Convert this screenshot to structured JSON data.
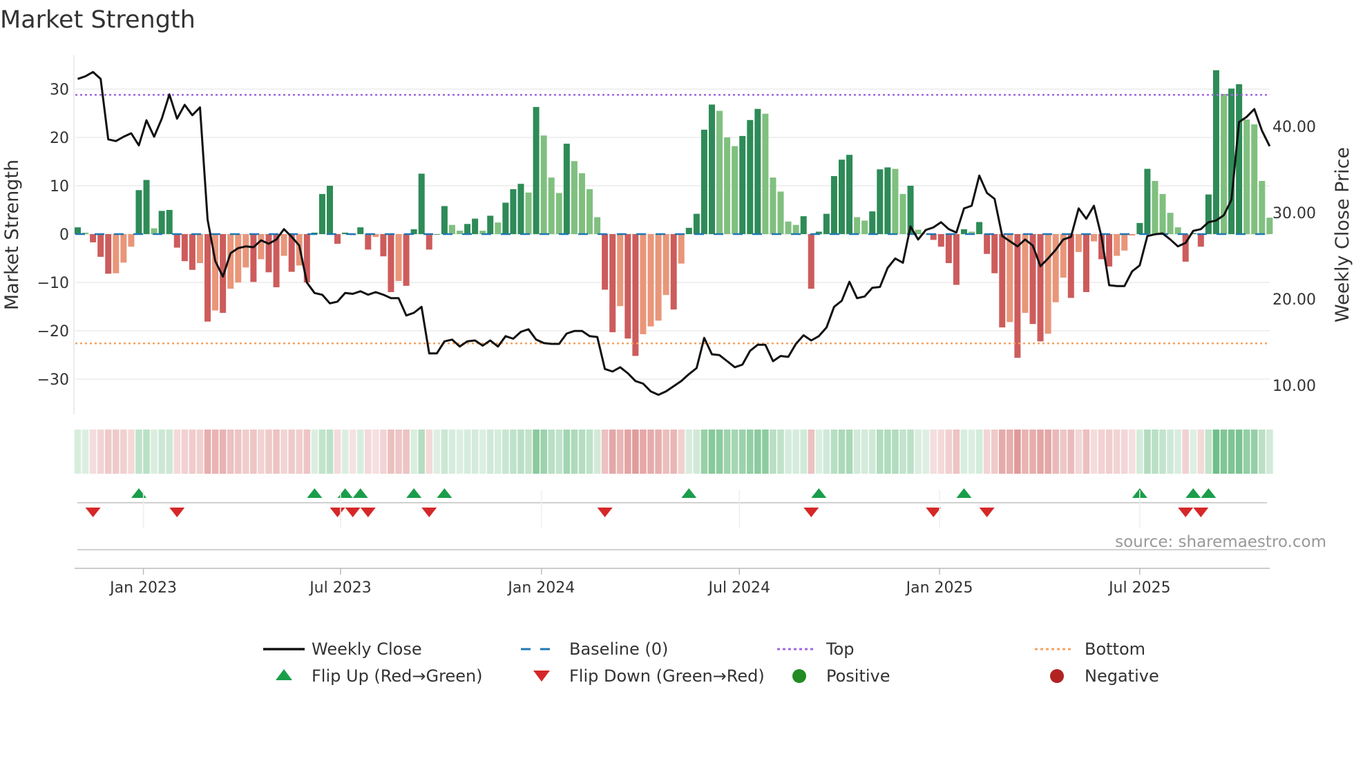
{
  "chart_data": {
    "type": "bar",
    "title": "Market Strength",
    "ylabel": "Market Strength",
    "y2label": "Weekly Close Price",
    "ylim": [
      -36,
      36
    ],
    "y2lim": [
      7,
      47
    ],
    "yticks": [
      "30",
      "20",
      "10",
      "0",
      "−10",
      "−20",
      "−30"
    ],
    "ytick_values": [
      30,
      20,
      10,
      0,
      -10,
      -20,
      -30
    ],
    "y2ticks": [
      "40.00",
      "30.00",
      "20.00",
      "10.00"
    ],
    "y2tick_values": [
      40,
      30,
      20,
      10
    ],
    "xticks": [
      "Jan 2023",
      "Jul 2023",
      "Jan 2024",
      "Jul 2024",
      "Jan 2025",
      "Jul 2025"
    ],
    "xtick_week_index": [
      8.6,
      34.4,
      60.7,
      86.6,
      112.8,
      139.0
    ],
    "top_level": 28.8,
    "bottom_level": -22.6,
    "baseline": 0,
    "strength": [
      1.4,
      0.3,
      -1.7,
      -4.7,
      -8.2,
      -8.1,
      -5.9,
      -2.6,
      9.1,
      11.2,
      1.2,
      4.8,
      5.0,
      -2.8,
      -5.6,
      -7.4,
      -6.0,
      -18.1,
      -15.8,
      -16.3,
      -11.3,
      -10.0,
      -6.9,
      -9.9,
      -5.2,
      -7.9,
      -11.0,
      -4.5,
      -7.8,
      -6.5,
      -10.0,
      0.3,
      8.3,
      10.0,
      -2.0,
      0.3,
      -0.2,
      1.4,
      -3.2,
      -0.6,
      -4.6,
      -12.0,
      -9.7,
      -10.7,
      1.0,
      12.5,
      -3.2,
      0,
      5.8,
      1.9,
      0.7,
      2.1,
      3.2,
      0.7,
      3.8,
      2.4,
      6.5,
      9.3,
      10.4,
      8.6,
      26.3,
      20.4,
      11.7,
      8.5,
      18.7,
      15.1,
      12.6,
      9.3,
      3.5,
      -11.5,
      -20.3,
      -14.9,
      -21.6,
      -25.2,
      -20.7,
      -19.1,
      -17.9,
      -12.6,
      -15.6,
      -6.1,
      1.3,
      4.2,
      21.6,
      26.8,
      25.5,
      20.0,
      18.2,
      20.3,
      23.6,
      25.9,
      24.9,
      11.7,
      8.8,
      2.6,
      1.9,
      3.7,
      -11.3,
      0.5,
      4.2,
      12.0,
      15.4,
      16.4,
      3.5,
      2.8,
      4.7,
      13.4,
      13.8,
      13.5,
      8.3,
      10.0,
      0.9,
      0.1,
      -1.2,
      -2.6,
      -6.0,
      -10.5,
      1.0,
      0.5,
      2.5,
      -4.1,
      -8.1,
      -19.3,
      -18.2,
      -25.6,
      -16.3,
      -18.6,
      -22.2,
      -20.6,
      -14.1,
      -9.0,
      -13.2,
      -3.7,
      -12.0,
      -1.5,
      -5.2,
      -6.7,
      -4.5,
      -3.4,
      -0.3,
      2.3,
      13.5,
      11.0,
      8.3,
      4.4,
      1.4,
      -5.7,
      0.2,
      -2.6,
      8.2,
      33.9,
      29.0,
      30.1,
      31.0,
      23.7,
      22.7,
      11.0,
      3.4
    ],
    "weekly_close": [
      45.5,
      45.8,
      46.3,
      45.5,
      38.5,
      38.3,
      38.8,
      39.2,
      37.8,
      40.7,
      38.8,
      40.9,
      43.7,
      40.9,
      42.5,
      41.3,
      42.2,
      29.2,
      24.4,
      22.6,
      25.3,
      25.9,
      26.1,
      26.0,
      26.8,
      26.4,
      26.9,
      28.1,
      27.2,
      26.2,
      21.9,
      20.7,
      20.5,
      19.5,
      19.7,
      20.7,
      20.6,
      20.9,
      20.5,
      20.8,
      20.5,
      20.1,
      20.1,
      18.1,
      18.4,
      19.1,
      13.7,
      13.7,
      15.1,
      15.3,
      14.5,
      15.1,
      15.2,
      14.6,
      15.2,
      14.5,
      15.7,
      15.4,
      16.2,
      16.5,
      15.3,
      14.9,
      14.8,
      14.8,
      16.0,
      16.3,
      16.3,
      15.7,
      15.6,
      11.9,
      11.6,
      12.1,
      11.4,
      10.5,
      10.2,
      9.3,
      8.9,
      9.3,
      9.9,
      10.5,
      11.3,
      12.0,
      15.5,
      13.6,
      13.5,
      12.8,
      12.1,
      12.4,
      14.0,
      14.7,
      14.7,
      12.8,
      13.4,
      13.3,
      14.8,
      15.8,
      15.2,
      15.7,
      16.7,
      19.1,
      19.8,
      22.0,
      20.1,
      20.3,
      21.3,
      21.4,
      23.6,
      24.7,
      24.2,
      28.4,
      26.9,
      28.0,
      28.3,
      28.9,
      28.1,
      27.7,
      30.5,
      30.8,
      34.3,
      32.3,
      31.6,
      27.3,
      26.7,
      26.1,
      26.9,
      26.2,
      23.8,
      24.7,
      25.7,
      26.9,
      27.2,
      30.5,
      29.3,
      30.8,
      27.2,
      21.6,
      21.5,
      21.5,
      23.2,
      23.9,
      27.3,
      27.5,
      27.6,
      26.9,
      26.1,
      26.5,
      27.9,
      28.1,
      28.9,
      29.1,
      29.7,
      31.5,
      40.5,
      41.1,
      42.0,
      39.5,
      37.7
    ],
    "flip_up_weeks": [
      9,
      32,
      36,
      38,
      45,
      49,
      81,
      98,
      117,
      140,
      147,
      149
    ],
    "flip_down_weeks": [
      3,
      14,
      35,
      37,
      39,
      47,
      70,
      97,
      113,
      120,
      146,
      148
    ],
    "legend": [
      {
        "label": "Weekly Close",
        "kind": "line"
      },
      {
        "label": "Baseline (0)",
        "kind": "dash"
      },
      {
        "label": "Top",
        "kind": "dot-top"
      },
      {
        "label": "Bottom",
        "kind": "dot-bottom"
      },
      {
        "label": "Flip Up (Red→Green)",
        "kind": "tri-up"
      },
      {
        "label": "Flip Down (Green→Red)",
        "kind": "tri-down"
      },
      {
        "label": "Positive",
        "kind": "dot-pos"
      },
      {
        "label": "Negative",
        "kind": "dot-neg"
      }
    ],
    "legend_placement": "bottom",
    "grid": true,
    "source": "source: sharemaestro.com",
    "colors": {
      "pos_up": "#2e8b57",
      "pos_down": "#80c07f",
      "neg_down": "#cd5c5c",
      "neg_up": "#e9967a",
      "line": "#111111",
      "baseline": "#1f77b4",
      "top": "#a066e0",
      "bottom": "#f4a261",
      "flip_up": "#1a9e4a",
      "flip_down": "#d62728",
      "positive": "#228b22",
      "negative": "#b22222"
    }
  }
}
